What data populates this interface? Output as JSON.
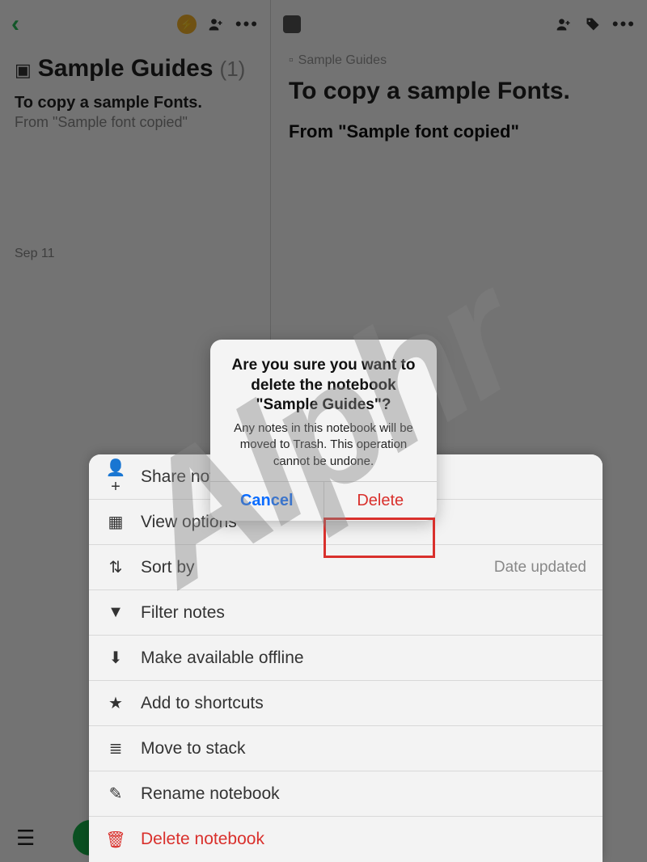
{
  "leftPane": {
    "notebook": {
      "title": "Sample Guides",
      "count": "(1)"
    },
    "notePreview": {
      "title": "To copy a sample Fonts.",
      "subtitle": "From \"Sample font copied\"",
      "date": "Sep 11"
    }
  },
  "rightPane": {
    "breadcrumb": "Sample Guides",
    "title": "To copy a sample Fonts.",
    "line1": "From \"Sample font copied\""
  },
  "actionSheet": {
    "items": [
      {
        "icon": "share-icon",
        "glyph": "👤+",
        "label": "Share notebook"
      },
      {
        "icon": "grid-icon",
        "glyph": "▦",
        "label": "View options"
      },
      {
        "icon": "sort-icon",
        "glyph": "⇅",
        "label": "Sort by",
        "trail": "Date updated"
      },
      {
        "icon": "filter-icon",
        "glyph": "▼",
        "label": "Filter notes"
      },
      {
        "icon": "download-icon",
        "glyph": "⬇",
        "label": "Make available offline"
      },
      {
        "icon": "star-icon",
        "glyph": "★",
        "label": "Add to shortcuts"
      },
      {
        "icon": "stack-icon",
        "glyph": "≣",
        "label": "Move to stack"
      },
      {
        "icon": "pencil-icon",
        "glyph": "✎",
        "label": "Rename notebook"
      },
      {
        "icon": "trash-icon",
        "glyph": "🗑",
        "label": "Delete notebook",
        "danger": true
      }
    ]
  },
  "alert": {
    "title": "Are you sure you want to delete the notebook \"Sample Guides\"?",
    "message": "Any notes in this notebook will be moved to Trash. This operation cannot be undone.",
    "cancel": "Cancel",
    "delete": "Delete"
  },
  "watermark": "Alphr"
}
